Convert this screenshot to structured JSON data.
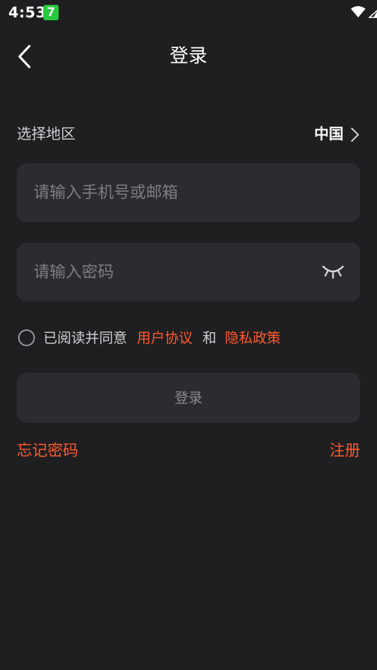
{
  "status_bar": {
    "time": "4:53",
    "notification_badge": "7",
    "icons": [
      "wifi-icon",
      "signal-icon",
      "battery-icon"
    ]
  },
  "header": {
    "title": "登录",
    "back_icon": "chevron-left-icon"
  },
  "region": {
    "label": "选择地区",
    "value": "中国",
    "chevron_icon": "chevron-right-icon"
  },
  "phone_field": {
    "value": "",
    "placeholder": "请输入手机号或邮箱"
  },
  "password_field": {
    "value": "",
    "placeholder": "请输入密码",
    "toggle_icon": "eye-closed-icon"
  },
  "agreement": {
    "checked": false,
    "prefix": "已阅读并同意",
    "user_agreement": "用户协议",
    "and": "和",
    "privacy_policy": "隐私政策"
  },
  "login_button": {
    "label": "登录"
  },
  "links": {
    "forgot_password": "忘记密码",
    "register": "注册"
  },
  "colors": {
    "background": "#1f1f21",
    "field_background": "#2c2c30",
    "accent": "#ff5a2b",
    "placeholder": "#7d7d82",
    "badge_green": "#27c93f"
  }
}
